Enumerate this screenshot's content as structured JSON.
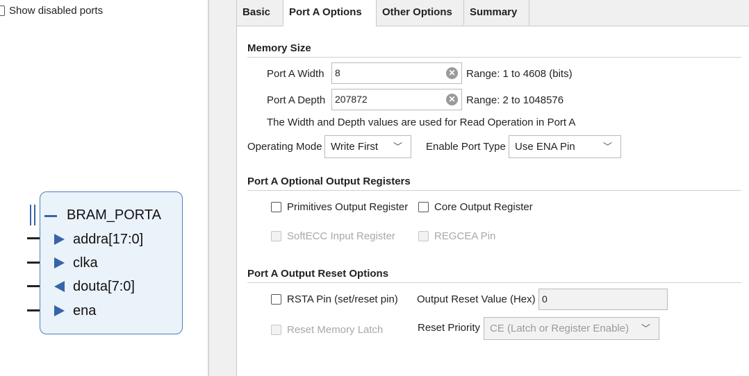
{
  "left_panel": {
    "show_disabled_label": "Show disabled ports",
    "block": {
      "interface": "BRAM_PORTA",
      "ports": [
        {
          "name": "addra[17:0]",
          "direction": "in"
        },
        {
          "name": "clka",
          "direction": "in"
        },
        {
          "name": "douta[7:0]",
          "direction": "out"
        },
        {
          "name": "ena",
          "direction": "in"
        }
      ]
    }
  },
  "tabs": [
    "Basic",
    "Port A Options",
    "Other Options",
    "Summary"
  ],
  "active_tab": "Port A Options",
  "memory_size": {
    "title": "Memory Size",
    "width_label": "Port A Width",
    "width_value": "8",
    "width_range": "Range: 1 to 4608 (bits)",
    "depth_label": "Port A Depth",
    "depth_value": "207872",
    "depth_range": "Range: 2 to 1048576",
    "note": "The Width and Depth values are used for Read Operation in Port A",
    "operating_mode_label": "Operating Mode",
    "operating_mode_value": "Write First",
    "enable_port_type_label": "Enable Port Type",
    "enable_port_type_value": "Use ENA Pin"
  },
  "optional_output_registers": {
    "title": "Port A Optional Output Registers",
    "primitives_label": "Primitives Output Register",
    "core_label": "Core Output Register",
    "softecc_label": "SoftECC Input Register",
    "regcea_label": "REGCEA Pin"
  },
  "output_reset": {
    "title": "Port A Output Reset Options",
    "rsta_label": "RSTA Pin (set/reset pin)",
    "reset_value_label": "Output Reset Value (Hex)",
    "reset_value": "0",
    "reset_latch_label": "Reset Memory Latch",
    "reset_priority_label": "Reset Priority",
    "reset_priority_value": "CE (Latch or Register Enable)"
  },
  "colors": {
    "block_border": "#4c7fb8",
    "block_fill": "#eaf2fa",
    "pin_arrow": "#3764a8"
  },
  "icons": {
    "clear": "clear-circle-icon",
    "dropdown": "chevron-down-icon",
    "port_in": "triangle-right-icon",
    "port_out": "triangle-left-icon"
  }
}
